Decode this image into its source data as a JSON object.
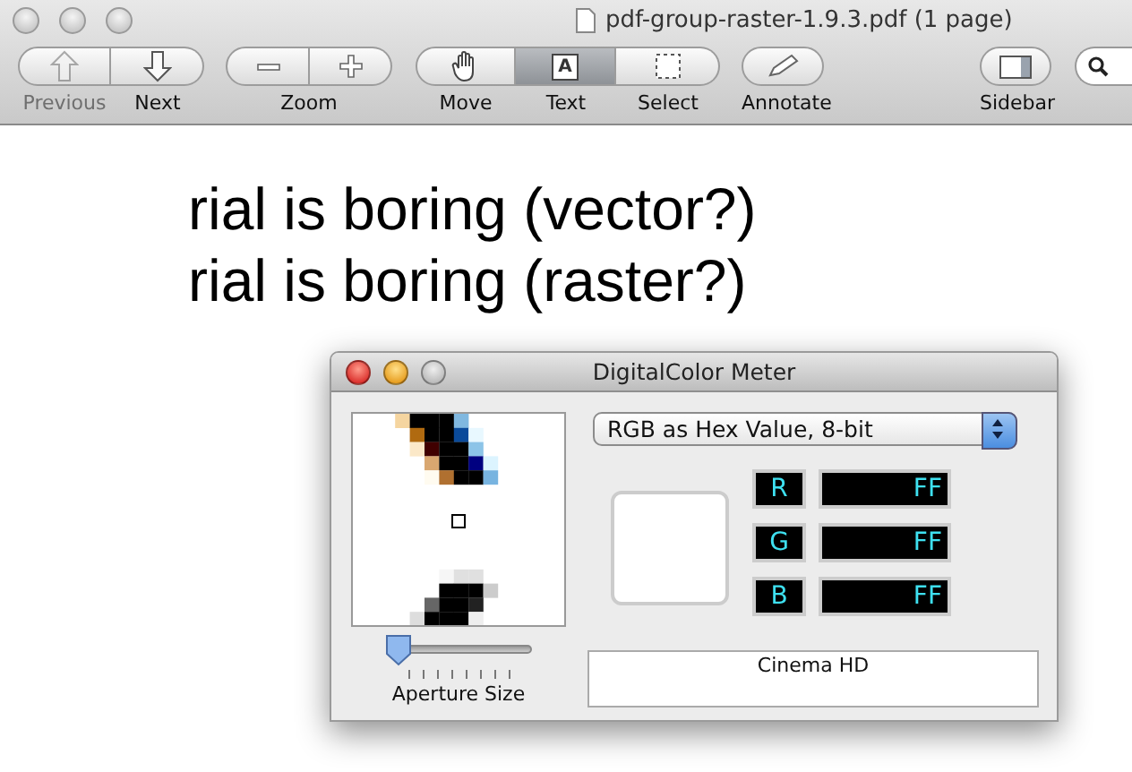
{
  "window": {
    "title": "pdf-group-raster-1.9.3.pdf (1 page)"
  },
  "toolbar": {
    "nav": [
      {
        "label": "Previous",
        "disabled": true
      },
      {
        "label": "Next",
        "disabled": false
      }
    ],
    "zoom": {
      "label": "Zoom"
    },
    "tools": [
      {
        "label": "Move",
        "selected": false
      },
      {
        "label": "Text",
        "selected": true,
        "glyph": "A"
      },
      {
        "label": "Select",
        "selected": false
      }
    ],
    "annotate": {
      "label": "Annotate"
    },
    "sidebar": {
      "label": "Sidebar"
    }
  },
  "document": {
    "lines": [
      "rial is boring (vector?)",
      "rial is boring (raster?)"
    ]
  },
  "color_meter": {
    "title": "DigitalColor Meter",
    "mode": "RGB as Hex Value, 8-bit",
    "aperture": {
      "label": "Aperture Size",
      "level": 0
    },
    "channels": [
      {
        "name": "R",
        "value": "FF"
      },
      {
        "name": "G",
        "value": "FF"
      },
      {
        "name": "B",
        "value": "FF"
      }
    ],
    "display": "Cinema HD"
  }
}
